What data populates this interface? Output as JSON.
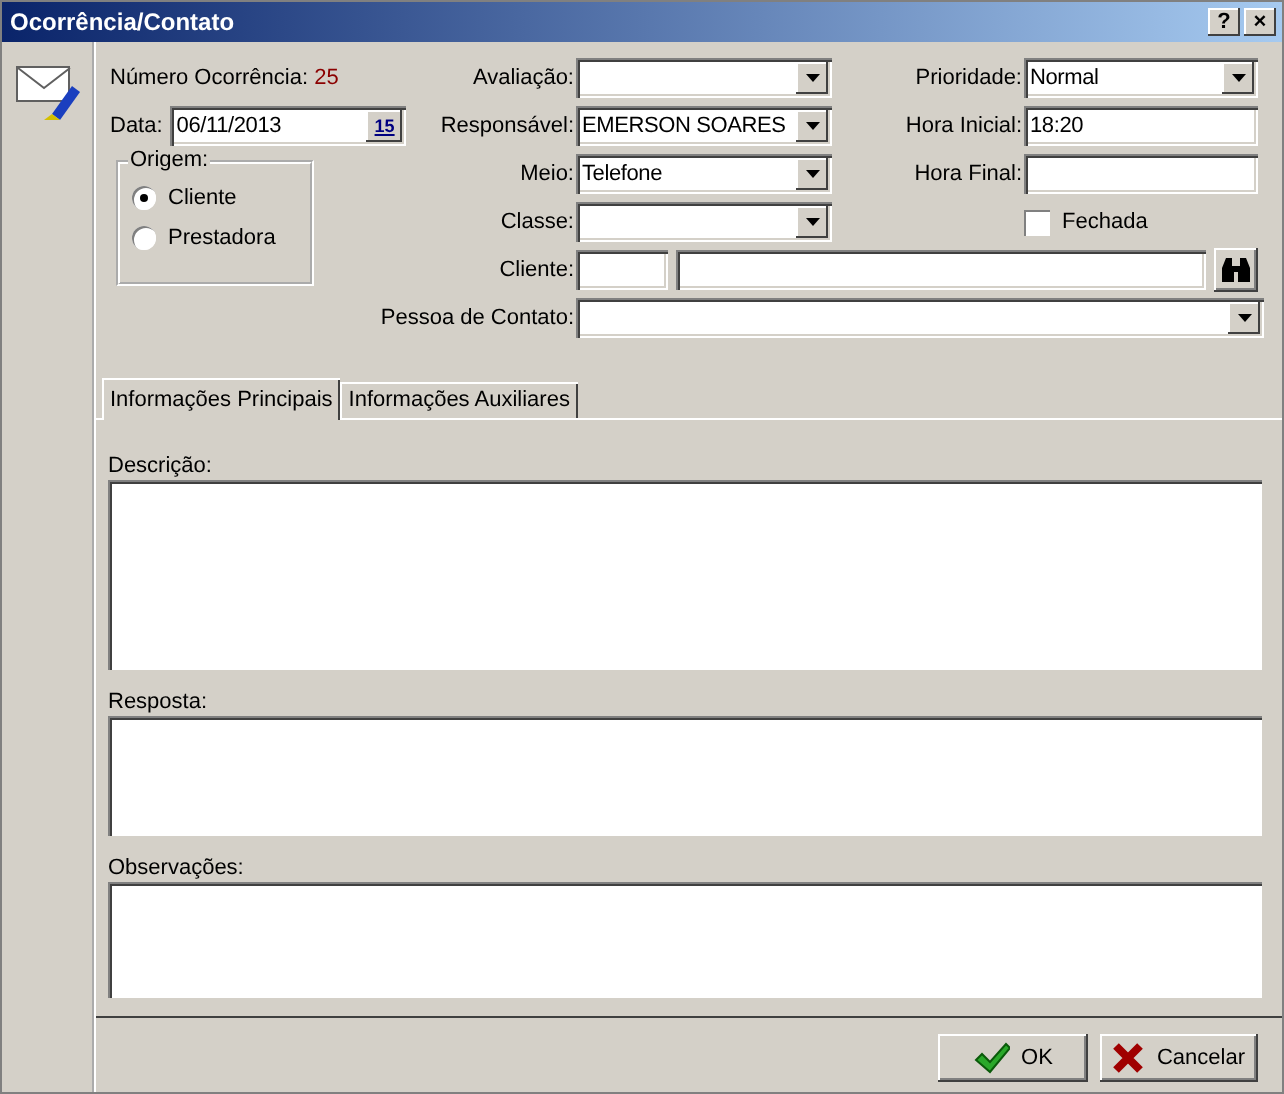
{
  "window": {
    "title": "Ocorrência/Contato",
    "buttons": [
      "?",
      "×"
    ]
  },
  "numero": {
    "label": "Número Ocorrência:",
    "value": "25"
  },
  "data": {
    "label": "Data:",
    "value": "06/11/2013",
    "button": "15"
  },
  "origem": {
    "label": "Origem:",
    "options": [
      {
        "label": "Cliente",
        "selected": true
      },
      {
        "label": "Prestadora",
        "selected": false
      }
    ]
  },
  "middle_fields": [
    {
      "label": "Avaliação:",
      "kind": "combo"
    },
    {
      "label": "Responsável:",
      "kind": "combo",
      "value": "EMERSON SOARES"
    },
    {
      "label": "Meio:",
      "kind": "combo",
      "value": "Telefone"
    },
    {
      "label": "Classe:",
      "kind": "combo"
    }
  ],
  "right_fields": [
    {
      "label": "Prioridade:",
      "kind": "combo",
      "value": "Normal"
    },
    {
      "label": "Hora Inicial:",
      "kind": "text",
      "value": "18:20"
    },
    {
      "label": "Hora Final:",
      "kind": "text"
    }
  ],
  "fechada": {
    "label": "Fechada",
    "checked": false
  },
  "cliente": {
    "label": "Cliente:"
  },
  "pessoa_contato": {
    "label": "Pessoa de Contato:"
  },
  "tabs": [
    {
      "label": "Informações Principais",
      "selected": true
    },
    {
      "label": "Informações Auxiliares",
      "selected": false
    }
  ],
  "memos": [
    {
      "label": "Descrição:"
    },
    {
      "label": "Resposta:"
    },
    {
      "label": "Observações:"
    }
  ],
  "actions": [
    {
      "label": "OK",
      "kind": "ok"
    },
    {
      "label": "Cancelar",
      "kind": "cancel"
    }
  ]
}
